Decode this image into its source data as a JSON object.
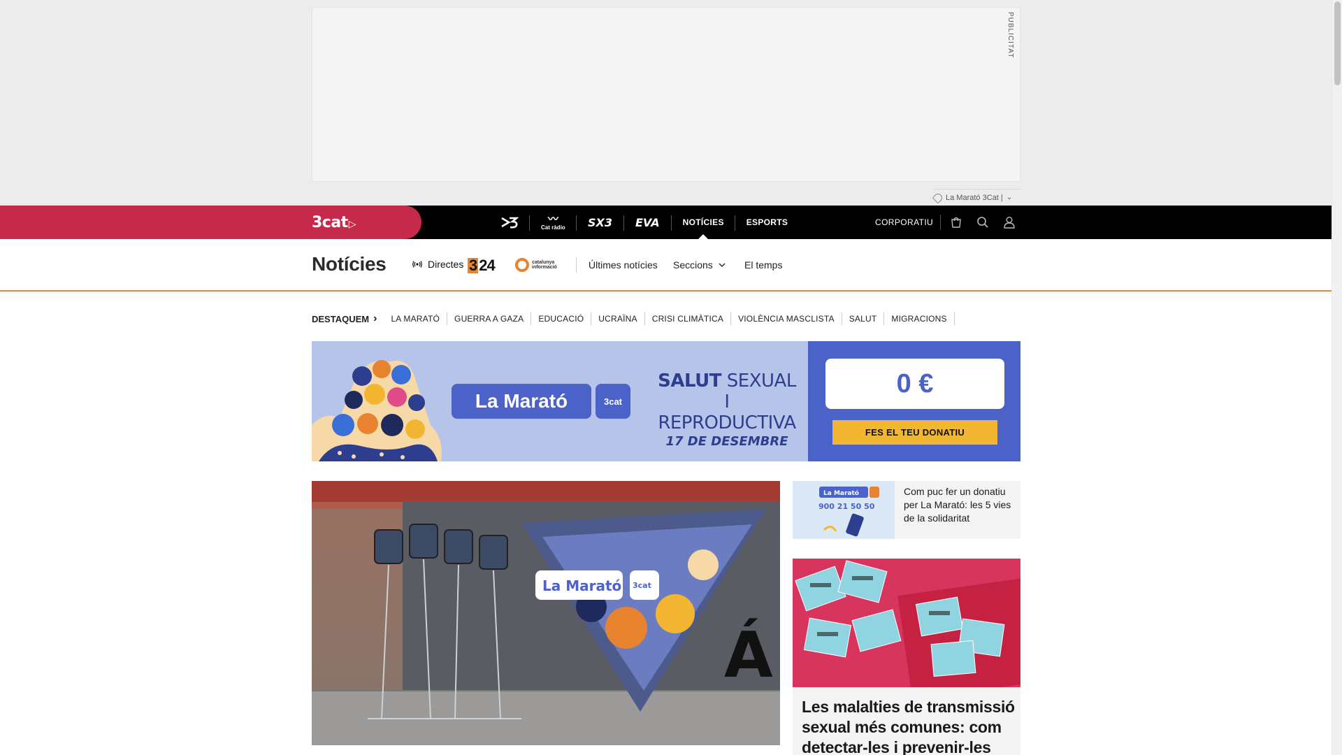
{
  "ad": {
    "label": "PUBLICITAT",
    "sponsor_link": "La Marató 3Cat |"
  },
  "topnav": {
    "logo": "3cat",
    "channels": [
      {
        "label": "3",
        "type": "logo"
      },
      {
        "label": "Cat ràdio",
        "type": "logo"
      },
      {
        "label": "SX3",
        "type": "logo"
      },
      {
        "label": "EVA",
        "type": "logo"
      },
      {
        "label": "NOTÍCIES",
        "type": "text"
      },
      {
        "label": "ESPORTS",
        "type": "text"
      }
    ],
    "corporatiu": "CORPORATIU",
    "icons": [
      "shopping-bag-icon",
      "search-icon",
      "user-icon"
    ]
  },
  "header": {
    "title": "Notícies",
    "directes": "Directes",
    "logo_324": {
      "a": "3",
      "b": "24"
    },
    "catinfo": {
      "l1": "catalunya",
      "l2": "informació"
    },
    "links": [
      "Últimes notícies",
      "Seccions",
      "El temps"
    ]
  },
  "destaquem": {
    "label": "DESTAQUEM",
    "items": [
      "LA MARATÓ",
      "GUERRA A GAZA",
      "EDUCACIÓ",
      "UCRAÏNA",
      "CRISI CLIMÀTICA",
      "VIOLÈNCIA MASCLISTA",
      "SALUT",
      "MIGRACIONS"
    ]
  },
  "banner": {
    "brand": "La Marató",
    "brand_cat": "3cat",
    "salut_bold": "SALUT",
    "salut_rest": "SEXUAL",
    "line2": "I REPRODUCTIVA",
    "date": "17 DE DESEMBRE",
    "amount": "0 €",
    "donate": "FES EL TEU DONATIU",
    "colors": {
      "bg": "#b7c4ea",
      "panel": "#4b63c8",
      "button": "#f2b633"
    }
  },
  "main_image": {
    "sign": "La Marató",
    "sign_cat": "3cat",
    "letter": "Á"
  },
  "side_card": {
    "title": "Com puc fer un donatiu per La Marató: les 5 vies de la solidaritat",
    "thumb_badge": "La Marató",
    "thumb_phone": "900 21 50 50"
  },
  "feature": {
    "title": "Les malalties de transmissió sexual més comunes: com detectar-les i prevenir-les"
  }
}
